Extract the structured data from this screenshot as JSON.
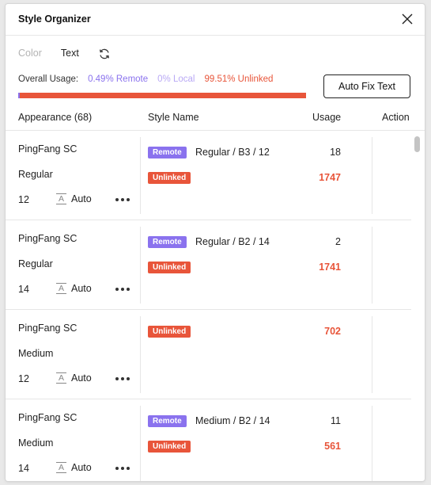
{
  "window": {
    "title": "Style Organizer"
  },
  "tabs": [
    {
      "label": "Color",
      "active": false
    },
    {
      "label": "Text",
      "active": true
    }
  ],
  "usage": {
    "label": "Overall Usage:",
    "remote": "0.49% Remote",
    "local": "0% Local",
    "unlinked": "99.51% Unlinked",
    "remote_fraction": 0.0049,
    "local_fraction": 0.0,
    "unlinked_fraction": 0.9951
  },
  "autofix_label": "Auto Fix Text",
  "table": {
    "headers": {
      "appearance": "Appearance (68)",
      "style_name": "Style Name",
      "usage": "Usage",
      "action": "Action"
    },
    "rows": [
      {
        "font": "PingFang SC",
        "weight": "Regular",
        "size": "12",
        "line_height": "Auto",
        "entries": [
          {
            "badge": "Remote",
            "style_name": "Regular / B3 / 12",
            "usage": "18"
          },
          {
            "badge": "Unlinked",
            "style_name": "",
            "usage": "1747"
          }
        ]
      },
      {
        "font": "PingFang SC",
        "weight": "Regular",
        "size": "14",
        "line_height": "Auto",
        "entries": [
          {
            "badge": "Remote",
            "style_name": "Regular / B2 / 14",
            "usage": "2"
          },
          {
            "badge": "Unlinked",
            "style_name": "",
            "usage": "1741"
          }
        ]
      },
      {
        "font": "PingFang SC",
        "weight": "Medium",
        "size": "12",
        "line_height": "Auto",
        "entries": [
          {
            "badge": "Unlinked",
            "style_name": "",
            "usage": "702"
          }
        ]
      },
      {
        "font": "PingFang SC",
        "weight": "Medium",
        "size": "14",
        "line_height": "Auto",
        "entries": [
          {
            "badge": "Remote",
            "style_name": "Medium / B2 / 14",
            "usage": "11"
          },
          {
            "badge": "Unlinked",
            "style_name": "",
            "usage": "561"
          }
        ]
      }
    ]
  },
  "icons": {
    "close": "close-icon",
    "refresh": "refresh-icon",
    "line_height": "line-height-icon",
    "more": "more-icon"
  },
  "colors": {
    "remote": "#8a72ee",
    "local": "#b9a9f5",
    "unlinked": "#e8553a"
  }
}
